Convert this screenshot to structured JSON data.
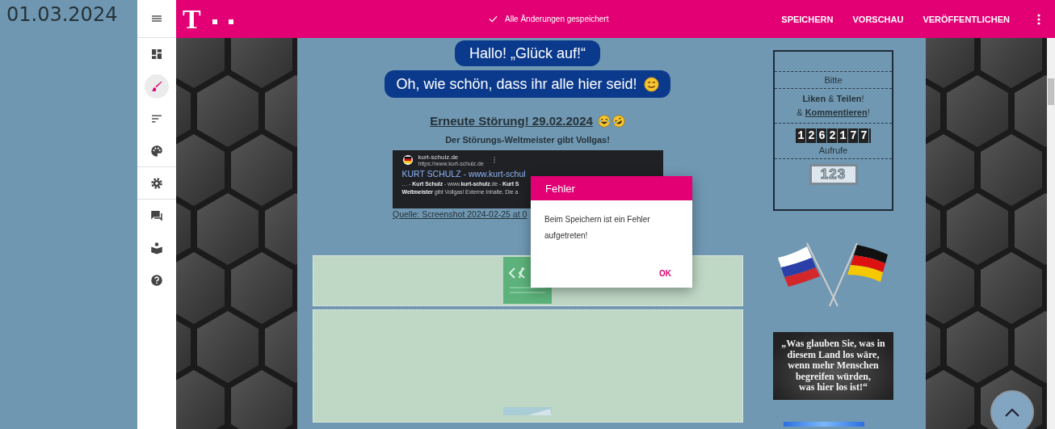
{
  "date": "01.03.2024",
  "sidebar": {
    "items": [
      {
        "kind": "menu",
        "selected": false
      },
      {
        "kind": "dashboard",
        "selected": false
      },
      {
        "kind": "brush",
        "selected": true
      },
      {
        "kind": "sort",
        "selected": false
      },
      {
        "kind": "palette",
        "selected": false
      },
      {
        "kind": "settings",
        "selected": false
      },
      {
        "kind": "chat",
        "selected": false
      },
      {
        "kind": "reader",
        "selected": false
      },
      {
        "kind": "help",
        "selected": false
      }
    ]
  },
  "topbar": {
    "logo": "T",
    "status": "Alle Änderungen gespeichert",
    "actions": [
      "SPEICHERN",
      "VORSCHAU",
      "VERÖFFENTLICHEN"
    ]
  },
  "page": {
    "bubbles": [
      {
        "text": "Hallo! „Glück auf!“"
      },
      {
        "text": "Oh, wie schön, dass ihr alle hier seid!"
      }
    ],
    "heading": "Erneute Störung! 29.02.2024",
    "subheading": "Der Störungs-Weltmeister gibt Vollgas!",
    "screenshot": {
      "site": "kurt-schulz.de",
      "url": "https://www.kurt-schulz.de",
      "title": "KURT SCHULZ - www.kurt-schul",
      "lines": [
        "… - **Kurt Schulz** - www.**kurt-schulz**.de - **Kurt S**",
        "**Weltmeister** gibt Vollgas! Externe Inhalte. Die a"
      ]
    },
    "caption": "Quelle: Screenshot 2024-02-25 at 0"
  },
  "aside": {
    "please": "Bitte",
    "call": "**Liken** & **Teilen**!",
    "call2_pre": "& ",
    "call2_link": "Kommentieren",
    "call2_post": "!",
    "counter": "1262177",
    "counter_label": "Aufrufe",
    "hits": "123",
    "quote": [
      "„Was glauben Sie, was in",
      "diesem Land los wäre,",
      "wenn mehr Menschen",
      "begreifen würden,",
      "was hier los ist!“"
    ]
  },
  "dialog": {
    "title": "Fehler",
    "message": "Beim Speichern ist ein Fehler aufgetreten!",
    "button": "OK"
  }
}
